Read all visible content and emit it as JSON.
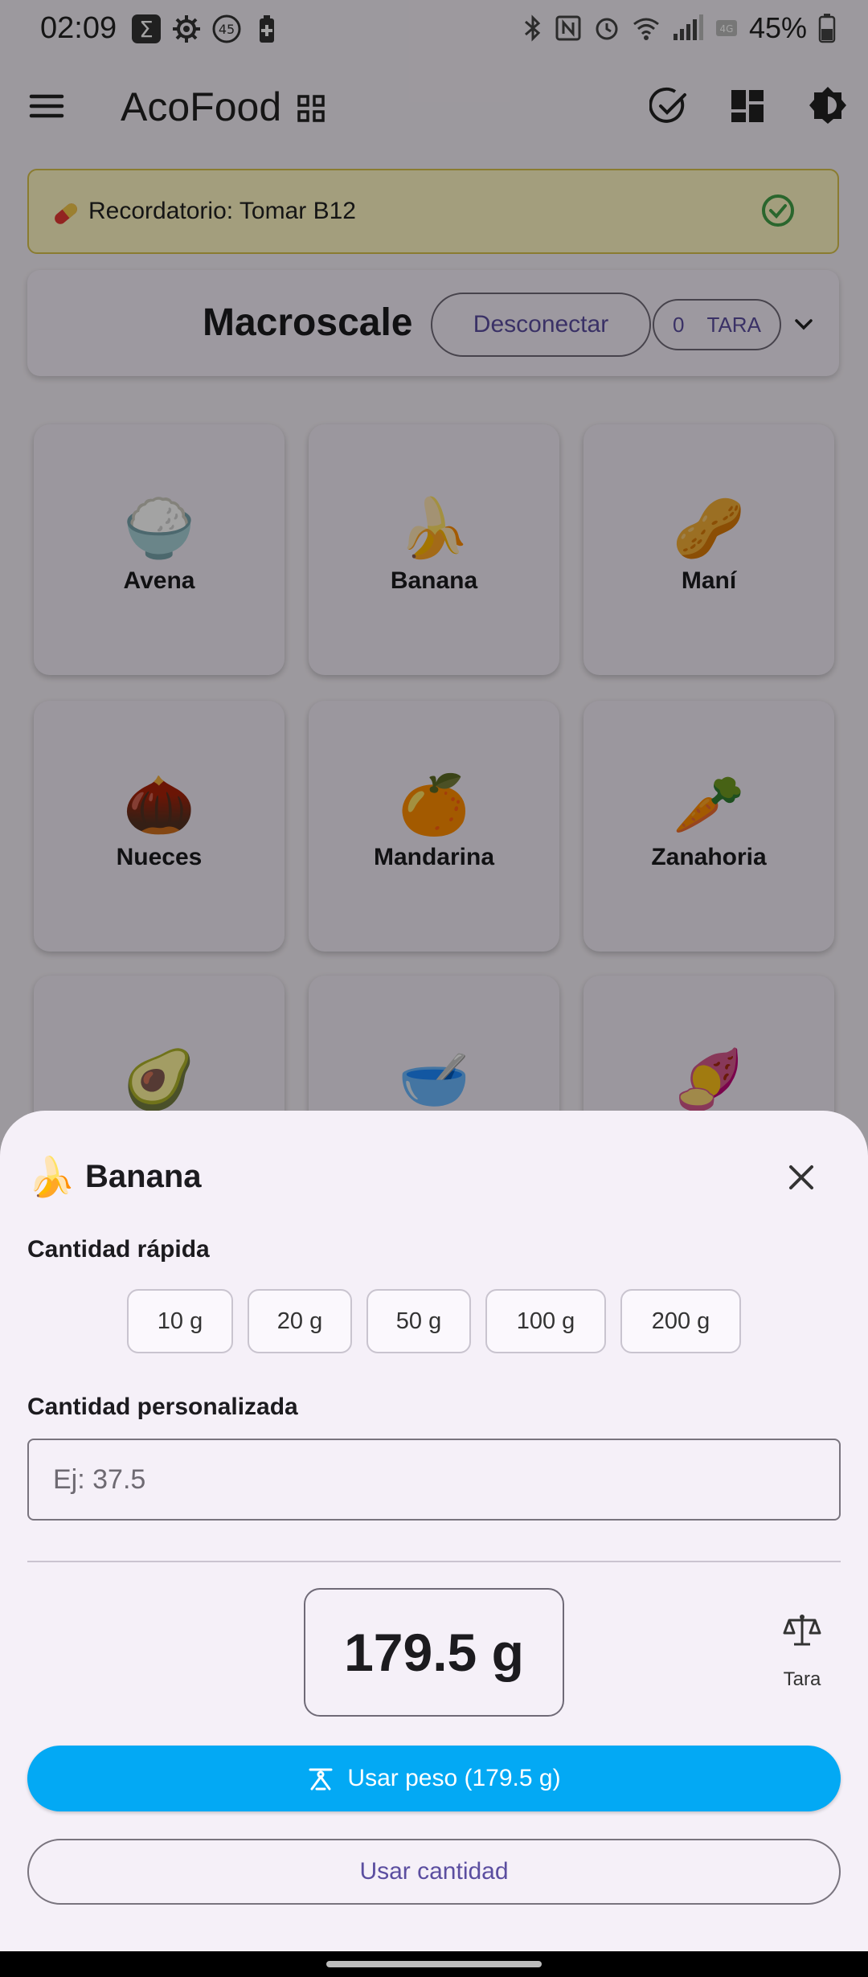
{
  "status_bar": {
    "time": "02:09",
    "battery_percent": "45%"
  },
  "app_bar": {
    "title": "AcoFood"
  },
  "reminder": {
    "text": "Recordatorio: Tomar B12"
  },
  "scale": {
    "title": "Macroscale",
    "disconnect_label": "Desconectar",
    "tare_value": "0",
    "tare_label": "TARA"
  },
  "foods": [
    {
      "emoji": "🍚",
      "name": "Avena"
    },
    {
      "emoji": "🍌",
      "name": "Banana"
    },
    {
      "emoji": "🥜",
      "name": "Maní"
    },
    {
      "emoji": "🌰",
      "name": "Nueces"
    },
    {
      "emoji": "🍊",
      "name": "Mandarina"
    },
    {
      "emoji": "🥕",
      "name": "Zanahoria"
    },
    {
      "emoji": "🥑",
      "name": ""
    },
    {
      "emoji": "🥣",
      "name": ""
    },
    {
      "emoji": "🍠",
      "name": ""
    }
  ],
  "sheet": {
    "emoji": "🍌",
    "title": "Banana",
    "quick_label": "Cantidad rápida",
    "quick_options": [
      "10 g",
      "20 g",
      "50 g",
      "100 g",
      "200 g"
    ],
    "custom_label": "Cantidad personalizada",
    "custom_placeholder": "Ej: 37.5",
    "custom_value": "",
    "current_weight": "179.5 g",
    "tara_label": "Tara",
    "use_weight_label": "Usar peso (179.5 g)",
    "use_amount_label": "Usar cantidad"
  },
  "colors": {
    "primary_button": "#03a9f4",
    "accent_text": "#5b4ea0",
    "reminder_bg": "#fff8c4"
  }
}
